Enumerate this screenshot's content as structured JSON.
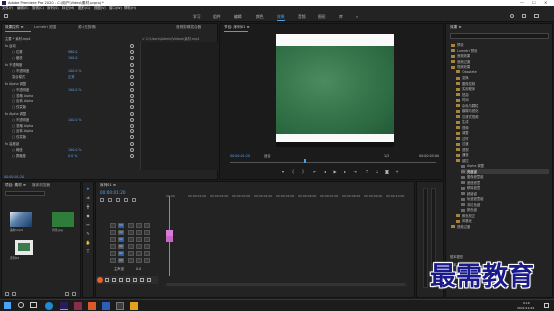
{
  "titlebar": {
    "title": "Adobe Premiere Pro 2020 - C:\\用户\\Video\\素材.prproj *",
    "minimize": "—",
    "maximize": "☐",
    "close": "✕"
  },
  "menu": [
    "文件(F)",
    "编辑(E)",
    "剪辑(C)",
    "序列(S)",
    "标记(M)",
    "图形(G)",
    "视图(V)",
    "窗口(W)",
    "帮助(H)"
  ],
  "workspaces": {
    "items": [
      "学习",
      "组件",
      "编辑",
      "颜色",
      "效果",
      "音频",
      "图形",
      "库"
    ],
    "active_index": 4
  },
  "effect_controls": {
    "tabs": [
      "效果控件 ≡",
      "Lumetri 范围",
      "源:(无剪辑)",
      "音频剪辑混合器"
    ],
    "clip_header": "主要 * 素材.mp4",
    "clip_path": "> C:\\Users\\Admin\\Videos\\素材.mp4",
    "sections": [
      {
        "name": "fx 运动",
        "rows": [
          {
            "label": "○ 位置",
            "value": "960.0"
          },
          {
            "label": "○ 缩放",
            "value": "100.0"
          }
        ]
      },
      {
        "name": "fx 不透明度",
        "rows": [
          {
            "label": "○ 不透明度",
            "value": "100.0 %"
          },
          {
            "label": "混合模式",
            "value": "正常"
          }
        ]
      },
      {
        "name": "fx Alpha 调整",
        "rows": [
          {
            "label": "○ 不透明度",
            "value": "100.0 %"
          },
          {
            "label": "□ 忽略 Alpha",
            "value": ""
          },
          {
            "label": "□ 反转 Alpha",
            "value": ""
          },
          {
            "label": "□ 仅蒙版",
            "value": ""
          }
        ]
      },
      {
        "name": "fx Alpha 调整",
        "rows": [
          {
            "label": "○ 不透明度",
            "value": "100.0 %"
          },
          {
            "label": "□ 忽略 Alpha",
            "value": ""
          },
          {
            "label": "□ 反转 Alpha",
            "value": ""
          },
          {
            "label": "□ 仅蒙版",
            "value": ""
          }
        ]
      },
      {
        "name": "fx 高度键",
        "rows": [
          {
            "label": "○ 阈值",
            "value": "100.0 %"
          },
          {
            "label": "○ 屏蔽度",
            "value": "0.0 %"
          }
        ]
      }
    ],
    "timecode": "00:00:01:20"
  },
  "program": {
    "tab": "节目: 序列01 ≡",
    "timecode_left": "00:00:01:20",
    "fit": "适合",
    "fraction": "1/2",
    "timecode_right": "00:00:05:00"
  },
  "project": {
    "tabs": [
      "项目: 素材 ≡",
      "媒体浏览器"
    ],
    "search_placeholder": "",
    "items": [
      {
        "name": "素材.mp4",
        "duration": "4:29",
        "color": "#1a6b5a"
      },
      {
        "name": "背景.jpg",
        "duration": "5:00",
        "color": "#2e7d3a"
      },
      {
        "name": "序列01",
        "duration": "5:00",
        "color": "#e8e8e8"
      }
    ]
  },
  "timeline": {
    "tab": "序列01 ≡",
    "timecode": "00:00:01:20",
    "ruler": [
      "00:00",
      "00:00:01:00",
      "00:00:02:00",
      "00:00:03:00",
      "00:00:04:00",
      "00:00:05:00",
      "00:00:06:00",
      "00:00:07:00",
      "00:00:08:00",
      "00:00:09:00",
      "00:00:10:00"
    ],
    "tracks": [
      "V3",
      "V2",
      "V1",
      "A1",
      "A2",
      "A3"
    ],
    "master": "主声道",
    "master_value": "0.0"
  },
  "effects": {
    "tab": "效果 ≡",
    "tree": [
      {
        "label": "预设",
        "level": 0
      },
      {
        "label": "Lumetri 预设",
        "level": 0
      },
      {
        "label": "音频效果",
        "level": 0
      },
      {
        "label": "音频过渡",
        "level": 0
      },
      {
        "label": "视频效果",
        "level": 0
      },
      {
        "label": "Obsolete",
        "level": 1
      },
      {
        "label": "变换",
        "level": 1
      },
      {
        "label": "图像控制",
        "level": 1
      },
      {
        "label": "实用程序",
        "level": 1
      },
      {
        "label": "扭曲",
        "level": 1
      },
      {
        "label": "时间",
        "level": 1
      },
      {
        "label": "杂色与颗粒",
        "level": 1
      },
      {
        "label": "模糊与锐化",
        "level": 1
      },
      {
        "label": "沉浸式视频",
        "level": 1
      },
      {
        "label": "生成",
        "level": 1
      },
      {
        "label": "视频",
        "level": 1
      },
      {
        "label": "调整",
        "level": 1
      },
      {
        "label": "过时",
        "level": 1
      },
      {
        "label": "过渡",
        "level": 1
      },
      {
        "label": "透视",
        "level": 1
      },
      {
        "label": "通道",
        "level": 1
      },
      {
        "label": "键控",
        "level": 1
      },
      {
        "label": "Alpha 调整",
        "level": 2
      },
      {
        "label": "亮度键",
        "level": 2,
        "selected": true
      },
      {
        "label": "图像遮罩键",
        "level": 2
      },
      {
        "label": "差值遮罩",
        "level": 2
      },
      {
        "label": "移除遮罩",
        "level": 2
      },
      {
        "label": "超级键",
        "level": 2
      },
      {
        "label": "轨道遮罩键",
        "level": 2
      },
      {
        "label": "非红色键",
        "level": 2
      },
      {
        "label": "颜色键",
        "level": 2
      },
      {
        "label": "颜色校正",
        "level": 1
      },
      {
        "label": "风格化",
        "level": 1
      },
      {
        "label": "视频过渡",
        "level": 0
      }
    ],
    "footer": [
      "基本图形",
      "基本声音",
      "Lumetri 颜色",
      "库"
    ]
  },
  "watermark": "最需教育",
  "taskbar": {
    "time": "9:16",
    "date": "2021/11/24",
    "search_icon": "search-icon"
  }
}
